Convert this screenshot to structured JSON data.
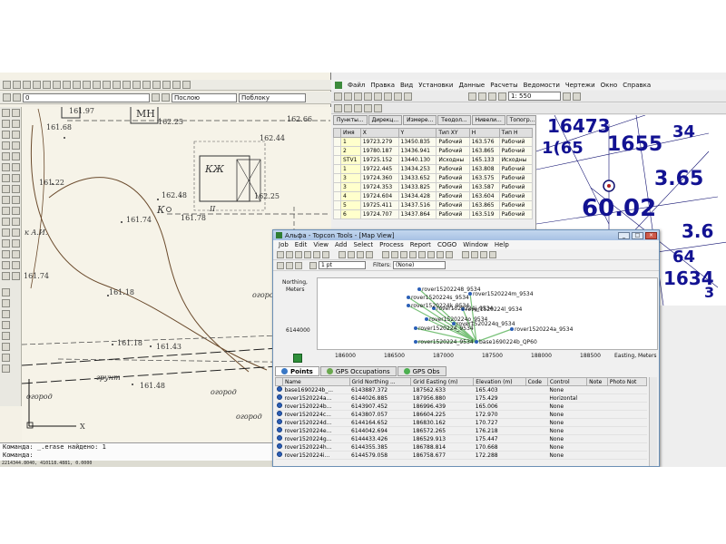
{
  "cad": {
    "layer_name": "0",
    "color_label": "Послою",
    "linetype_label": "Поблоку",
    "command_lines": [
      "Команда: _.erase найдено: 1",
      "Команда:"
    ],
    "status_coords": "2214344.8040, 410118.4881, 0.0000",
    "map_labels": [
      {
        "text": "161.97",
        "x": 52,
        "y": 0
      },
      {
        "text": "МН",
        "x": 126,
        "y": 1,
        "big": true
      },
      {
        "text": "162.25",
        "x": 150,
        "y": 12
      },
      {
        "text": "162.66",
        "x": 292,
        "y": 9
      },
      {
        "text": "161.68",
        "x": 27,
        "y": 18
      },
      {
        "text": "162.44",
        "x": 262,
        "y": 30
      },
      {
        "text": "КЖ",
        "x": 202,
        "y": 62,
        "big": true,
        "it": true
      },
      {
        "text": "161.22",
        "x": 19,
        "y": 79
      },
      {
        "text": "162.48",
        "x": 154,
        "y": 93
      },
      {
        "text": "162.25",
        "x": 256,
        "y": 94
      },
      {
        "text": "К",
        "x": 149,
        "y": 107,
        "it": true,
        "big": true
      },
      {
        "text": "161.74",
        "x": 115,
        "y": 120
      },
      {
        "text": "161.78",
        "x": 175,
        "y": 118
      },
      {
        "text": "II",
        "x": 207,
        "y": 108,
        "it": true
      },
      {
        "text": "к А.И.",
        "x": 3,
        "y": 134,
        "it": true
      },
      {
        "text": "161.74",
        "x": 2,
        "y": 182
      },
      {
        "text": "161.18",
        "x": 96,
        "y": 200
      },
      {
        "text": "огород",
        "x": 254,
        "y": 203,
        "it": true
      },
      {
        "text": "161.9",
        "x": 279,
        "y": 190
      },
      {
        "text": "161.18",
        "x": 105,
        "y": 256
      },
      {
        "text": "161.43",
        "x": 148,
        "y": 260
      },
      {
        "text": "грунт",
        "x": 82,
        "y": 294,
        "it": true
      },
      {
        "text": "161.48",
        "x": 130,
        "y": 303
      },
      {
        "text": "огород",
        "x": 5,
        "y": 315,
        "it": true
      },
      {
        "text": "огород",
        "x": 208,
        "y": 310,
        "it": true
      },
      {
        "text": "огород",
        "x": 236,
        "y": 337,
        "it": true
      },
      {
        "text": "X",
        "x": 64,
        "y": 348
      }
    ]
  },
  "survey": {
    "menu": [
      "Файл",
      "Правка",
      "Вид",
      "Установки",
      "Данные",
      "Расчеты",
      "Ведомости",
      "Чертежи",
      "Окно",
      "Справка"
    ],
    "zoom_value": "1: 550",
    "tabs": [
      "Пункты...",
      "Дирекц...",
      "Измере...",
      "Теодол...",
      "Нивели...",
      "Топогр..."
    ],
    "table_headers": [
      "",
      "Имя",
      "X",
      "Y",
      "Тип XY",
      "H",
      "Тип H"
    ],
    "rows": [
      [
        "",
        "1",
        "19723.279",
        "13450.835",
        "Рабочий",
        "163.576",
        "Рабочий"
      ],
      [
        "",
        "2",
        "19780.187",
        "13436.941",
        "Рабочий",
        "163.865",
        "Рабочий"
      ],
      [
        "",
        "STV1",
        "19725.152",
        "13440.130",
        "Исходны",
        "165.133",
        "Исходны"
      ],
      [
        "",
        "1",
        "19722.445",
        "13434.253",
        "Рабочий",
        "163.808",
        "Рабочий"
      ],
      [
        "",
        "3",
        "19724.360",
        "13433.652",
        "Рабочий",
        "163.575",
        "Рабочий"
      ],
      [
        "",
        "3",
        "19724.353",
        "13433.825",
        "Рабочий",
        "163.587",
        "Рабочий"
      ],
      [
        "",
        "4",
        "19724.604",
        "13434.428",
        "Рабочий",
        "163.604",
        "Рабочий"
      ],
      [
        "",
        "5",
        "19725.411",
        "13437.516",
        "Рабочий",
        "163.865",
        "Рабочий"
      ],
      [
        "",
        "6",
        "19724.707",
        "13437.864",
        "Рабочий",
        "163.519",
        "Рабочий"
      ]
    ],
    "map_blobs": [
      {
        "text": "16473",
        "x": 12,
        "y": 2,
        "s": 20
      },
      {
        "text": "1(65",
        "x": 6,
        "y": 28,
        "s": 18
      },
      {
        "text": "1655",
        "x": 78,
        "y": 22,
        "s": 22
      },
      {
        "text": "34",
        "x": 150,
        "y": 10,
        "s": 18
      },
      {
        "text": "3.65",
        "x": 130,
        "y": 60,
        "s": 22
      },
      {
        "text": "60.02",
        "x": 50,
        "y": 90,
        "s": 26
      },
      {
        "text": "3.6",
        "x": 160,
        "y": 118,
        "s": 20
      },
      {
        "text": "64",
        "x": 150,
        "y": 148,
        "s": 18
      },
      {
        "text": "1634",
        "x": 140,
        "y": 170,
        "s": 20
      },
      {
        "text": "3",
        "x": 185,
        "y": 188,
        "s": 16
      }
    ]
  },
  "topcon": {
    "title": "Альфа - Topcon Tools - [Map View]",
    "menu": [
      "Job",
      "Edit",
      "View",
      "Add",
      "Select",
      "Process",
      "Report",
      "COGO",
      "Window",
      "Help"
    ],
    "width_value": "1 pt",
    "filter_label": "Filters:",
    "filter_value": "(None)",
    "y_axis_label": [
      "Northing,",
      "Meters"
    ],
    "y_tick": "6144000",
    "x_ticks": [
      "186000",
      "186500",
      "187000",
      "187500",
      "188000",
      "188500"
    ],
    "x_axis_label": "Easting, Meters",
    "map_points": [
      {
        "label": "rover15202248_9534",
        "x": 112,
        "y": 9
      },
      {
        "label": "rover1520224m_9534",
        "x": 168,
        "y": 14
      },
      {
        "label": "rover1520224s_9534",
        "x": 100,
        "y": 18
      },
      {
        "label": "rover1520224k_9534",
        "x": 100,
        "y": 27
      },
      {
        "label": "rover1520224j_9534",
        "x": 128,
        "y": 30
      },
      {
        "label": "rover1520224l_9534",
        "x": 160,
        "y": 31
      },
      {
        "label": "rover1520224o_9534",
        "x": 120,
        "y": 42
      },
      {
        "label": "rover1520224_9534",
        "x": 108,
        "y": 52
      },
      {
        "label": "rover1520224q_9534",
        "x": 150,
        "y": 47
      },
      {
        "label": "rover1520224a_9534",
        "x": 214,
        "y": 53
      },
      {
        "label": "rover1520224_9534",
        "x": 108,
        "y": 67
      },
      {
        "label": "base1690224b_QP60",
        "x": 175,
        "y": 67
      }
    ],
    "tabs": [
      "Points",
      "GPS Occupations",
      "GPS Obs"
    ],
    "grid_headers": [
      "",
      "Name",
      "Grid Northing ...",
      "Grid Easting (m)",
      "Elevation (m)",
      "Code",
      "Control",
      "Note",
      "Photo Not"
    ],
    "grid_rows": [
      [
        "base1690224b_...",
        "6143887.372",
        "187562.633",
        "165.403",
        "",
        "None"
      ],
      [
        "rover1520224a...",
        "6144026.885",
        "187956.880",
        "175.429",
        "",
        "Horizontal"
      ],
      [
        "rover1520224b...",
        "6143907.452",
        "186996.439",
        "165.006",
        "",
        "None"
      ],
      [
        "rover1520224c...",
        "6143807.057",
        "186604.225",
        "172.970",
        "",
        "None"
      ],
      [
        "rover1520224d...",
        "6144164.652",
        "186830.162",
        "170.727",
        "",
        "None"
      ],
      [
        "rover1520224e...",
        "6144042.694",
        "186572.265",
        "176.218",
        "",
        "None"
      ],
      [
        "rover1520224g...",
        "6144433.426",
        "186529.913",
        "175.447",
        "",
        "None"
      ],
      [
        "rover1520224h...",
        "6144355.385",
        "186788.814",
        "170.668",
        "",
        "None"
      ],
      [
        "rover1520224i...",
        "6144579.058",
        "186758.677",
        "172.288",
        "",
        "None"
      ]
    ]
  }
}
